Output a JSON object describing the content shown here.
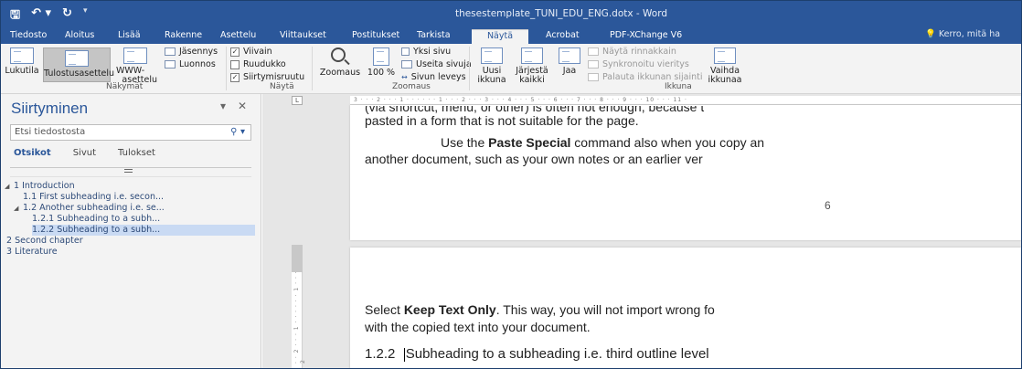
{
  "window": {
    "title": "thesestemplate_TUNI_EDU_ENG.dotx - Word"
  },
  "quick_access": {
    "save_icon": "save-icon",
    "undo_icon": "undo-icon",
    "redo_icon": "redo-icon"
  },
  "tabs": [
    "Tiedosto",
    "Aloitus",
    "Lisää",
    "Rakenne",
    "Asettelu",
    "Viittaukset",
    "Postitukset",
    "Tarkista",
    "Näytä",
    "Acrobat",
    "PDF-XChange V6"
  ],
  "active_tab": "Näytä",
  "tell_me": "Kerro, mitä ha",
  "ribbon": {
    "views": {
      "label": "Näkymät",
      "lukutila": "Lukutila",
      "tulostus": "Tulostusasettelu",
      "www1": "WWW-",
      "www2": "asettelu",
      "jasennys": "Jäsennys",
      "luonnos": "Luonnos"
    },
    "show": {
      "label": "Näytä",
      "viivain": "Viivain",
      "viivain_checked": true,
      "ruudukko": "Ruudukko",
      "ruudukko_checked": false,
      "siirtymis": "Siirtymisruutu",
      "siirtymis_checked": true
    },
    "zoom": {
      "label": "Zoomaus",
      "zoomaus": "Zoomaus",
      "percent": "100 %",
      "yksi": "Yksi sivu",
      "useita": "Useita sivuja",
      "leveys": "Sivun leveys"
    },
    "window": {
      "label": "Ikkuna",
      "uusi1": "Uusi",
      "uusi2": "ikkuna",
      "jarjesta1": "Järjestä",
      "jarjesta2": "kaikki",
      "jaa": "Jaa",
      "rinnakkain": "Näytä rinnakkain",
      "synk": "Synkronoitu vieritys",
      "palauta": "Palauta ikkunan sijainti",
      "vaihda1": "Vaihda",
      "vaihda2": "ikkunaa"
    }
  },
  "nav": {
    "title": "Siirtyminen",
    "search_placeholder": "Etsi tiedostosta",
    "tabs": [
      "Otsikot",
      "Sivut",
      "Tulokset"
    ],
    "items": [
      {
        "text": "1 Introduction",
        "expanded": true
      },
      {
        "text": "1.1 First subheading i.e. secon..."
      },
      {
        "text": "1.2 Another subheading i.e. se...",
        "expanded": true
      },
      {
        "text": "1.2.1 Subheading to a subh..."
      },
      {
        "text": "1.2.2 Subheading to a subh...",
        "selected": true
      },
      {
        "text": "2 Second chapter"
      },
      {
        "text": "3 Literature"
      }
    ]
  },
  "ruler": {
    "top": "3 · · · 2 · · · 1 · · ·  · · · 1 · · · 2 · · · 3 · · · 4 · · · 5 · · · 6 · · · 7 · · · 8 · · · 9 · · · 10 · · · 11 ·",
    "left": "· · 2 · · · 1 · · ·  · · · 1 · · · 2"
  },
  "document": {
    "p1_l0": "(via shortcut, menu, or other) is often not enough, because t",
    "p1_l1": "pasted in a form that is not suitable for the page.",
    "p1_l2a": "Use the ",
    "p1_l2b": "Paste Special",
    "p1_l2c": " command also when you copy an",
    "p1_l3": "another document, such as your own notes or an earlier ver",
    "page_number": "6",
    "p2_l1a": "Select ",
    "p2_l1b": "Keep Text Only",
    "p2_l1c": ". This way, you will not import wrong fo",
    "p2_l2": "with the copied text into your document.",
    "p2_h_num": "1.2.2",
    "p2_h_text": "Subheading to a subheading i.e. third outline level"
  }
}
